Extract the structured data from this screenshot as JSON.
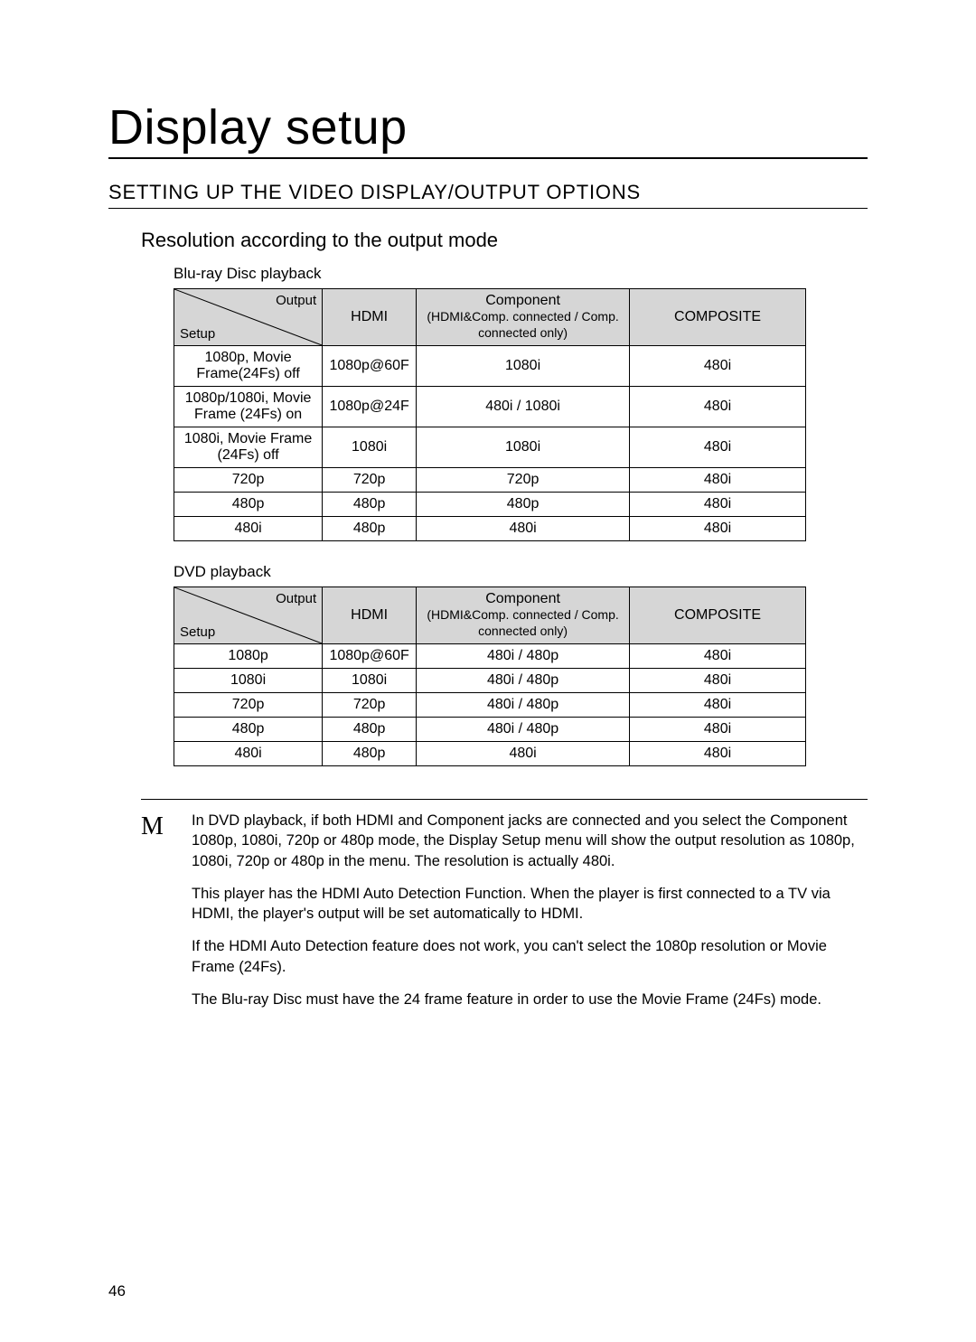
{
  "title": "Display setup",
  "section_heading": "SETTING UP THE VIDEO DISPLAY/OUTPUT OPTIONS",
  "sub_heading": "Resolution according to the output mode",
  "page_number": "46",
  "diag_labels": {
    "output": "Output",
    "setup": "Setup"
  },
  "table_headers": {
    "hdmi": "HDMI",
    "component_line1": "Component",
    "component_line2": "(HDMI&Comp. connected / Comp. connected only)",
    "composite": "COMPOSITE"
  },
  "tables": [
    {
      "caption": "Blu-ray Disc playback",
      "rows": [
        {
          "setup": "1080p, Movie Frame(24Fs) off",
          "hdmi": "1080p@60F",
          "component": "1080i",
          "composite": "480i"
        },
        {
          "setup": "1080p/1080i, Movie Frame (24Fs) on",
          "hdmi": "1080p@24F",
          "component": "480i / 1080i",
          "composite": "480i"
        },
        {
          "setup": "1080i, Movie Frame (24Fs) off",
          "hdmi": "1080i",
          "component": "1080i",
          "composite": "480i"
        },
        {
          "setup": "720p",
          "hdmi": "720p",
          "component": "720p",
          "composite": "480i"
        },
        {
          "setup": "480p",
          "hdmi": "480p",
          "component": "480p",
          "composite": "480i"
        },
        {
          "setup": "480i",
          "hdmi": "480p",
          "component": "480i",
          "composite": "480i"
        }
      ]
    },
    {
      "caption": "DVD playback",
      "rows": [
        {
          "setup": "1080p",
          "hdmi": "1080p@60F",
          "component": "480i / 480p",
          "composite": "480i"
        },
        {
          "setup": "1080i",
          "hdmi": "1080i",
          "component": "480i / 480p",
          "composite": "480i"
        },
        {
          "setup": "720p",
          "hdmi": "720p",
          "component": "480i / 480p",
          "composite": "480i"
        },
        {
          "setup": "480p",
          "hdmi": "480p",
          "component": "480i / 480p",
          "composite": "480i"
        },
        {
          "setup": "480i",
          "hdmi": "480p",
          "component": "480i",
          "composite": "480i"
        }
      ]
    }
  ],
  "notes_icon": "M",
  "notes": [
    "In DVD playback, if both HDMI and Component jacks are connected and you select the Component 1080p, 1080i, 720p or 480p mode, the Display Setup menu will show the output resolution as 1080p, 1080i, 720p or 480p in the menu.\nThe resolution is actually 480i.",
    "This player has the HDMI Auto Detection Function. When the player is ﬁrst connected to a TV via HDMI, the player's output will be set automatically to HDMI.",
    "If the HDMI Auto Detection feature does not work, you can't select the 1080p resolution or Movie Frame (24Fs).",
    "The Blu-ray Disc must have the 24 frame feature in order to use the Movie Frame (24Fs) mode."
  ]
}
